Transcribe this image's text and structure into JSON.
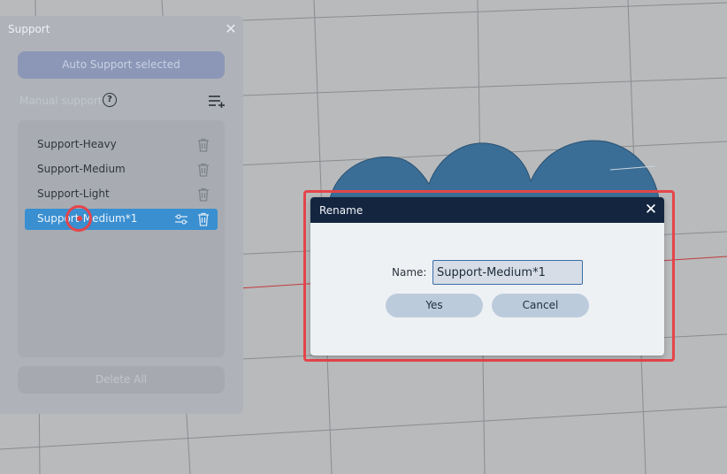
{
  "support_panel": {
    "title": "Support",
    "auto_support_label": "Auto Support selected",
    "manual_support_label": "Manual support",
    "items": [
      {
        "label": "Support-Heavy"
      },
      {
        "label": "Support-Medium"
      },
      {
        "label": "Support-Light"
      },
      {
        "label": "Support-Medium*1",
        "selected": true
      }
    ],
    "delete_all_label": "Delete All"
  },
  "rename_dialog": {
    "title": "Rename",
    "name_label": "Name:",
    "name_value": "Support-Medium*1",
    "yes_label": "Yes",
    "cancel_label": "Cancel"
  },
  "colors": {
    "accent": "#3a8fd0",
    "dialog_header": "#142540",
    "highlight": "#e4454a",
    "model": "#3b6e96"
  },
  "icons": [
    "close-icon",
    "help-icon",
    "add-list-icon",
    "trash-icon",
    "adjust-icon"
  ]
}
